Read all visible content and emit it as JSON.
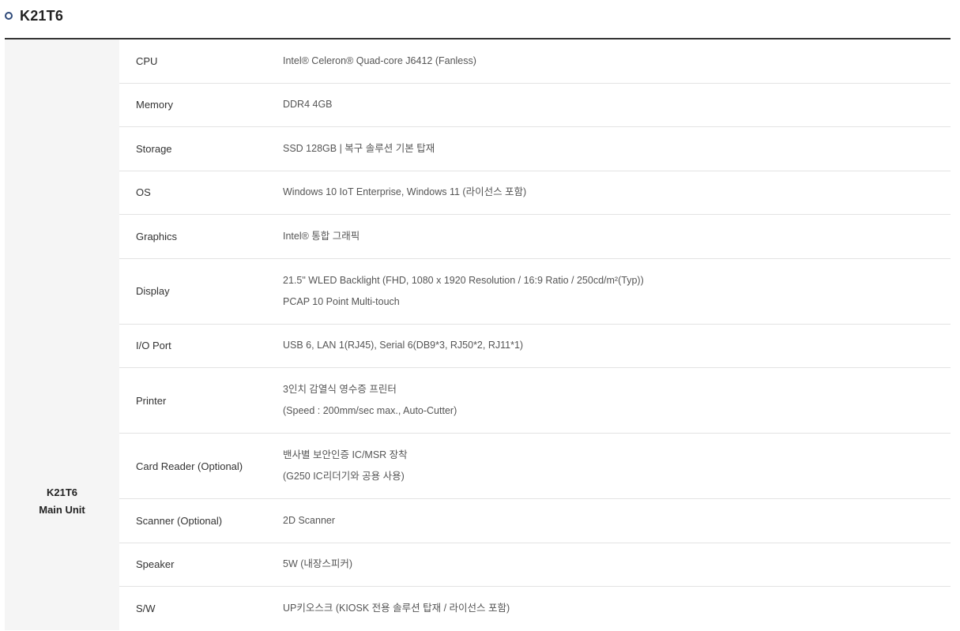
{
  "header": {
    "title": "K21T6"
  },
  "unit": {
    "line1": "K21T6",
    "line2": "Main Unit"
  },
  "specs": [
    {
      "label": "CPU",
      "lines": [
        "Intel® Celeron® Quad-core J6412 (Fanless)"
      ]
    },
    {
      "label": "Memory",
      "lines": [
        "DDR4 4GB"
      ]
    },
    {
      "label": "Storage",
      "lines": [
        "SSD 128GB | 복구 솔루션 기본 탑재"
      ]
    },
    {
      "label": "OS",
      "lines": [
        "Windows 10 IoT Enterprise, Windows 11 (라이선스 포함)"
      ]
    },
    {
      "label": "Graphics",
      "lines": [
        "Intel® 통합 그래픽"
      ]
    },
    {
      "label": "Display",
      "lines": [
        "21.5\" WLED Backlight (FHD, 1080 x 1920 Resolution / 16:9 Ratio / 250cd/m²(Typ))",
        "PCAP 10 Point Multi-touch"
      ]
    },
    {
      "label": "I/O Port",
      "lines": [
        "USB 6, LAN 1(RJ45), Serial 6(DB9*3, RJ50*2, RJ11*1)"
      ]
    },
    {
      "label": "Printer",
      "lines": [
        "3인치 감열식 영수증 프린터",
        "(Speed : 200mm/sec max., Auto-Cutter)"
      ]
    },
    {
      "label": "Card Reader (Optional)",
      "lines": [
        "밴사별 보안인증 IC/MSR 장착",
        "(G250 IC리더기와 공용 사용)"
      ]
    },
    {
      "label": "Scanner (Optional)",
      "lines": [
        "2D Scanner"
      ]
    },
    {
      "label": "Speaker",
      "lines": [
        "5W (내장스피커)"
      ]
    },
    {
      "label": "S/W",
      "lines": [
        "UP키오스크 (KIOSK 전용 솔루션 탑재 / 라이선스 포함)"
      ]
    }
  ]
}
